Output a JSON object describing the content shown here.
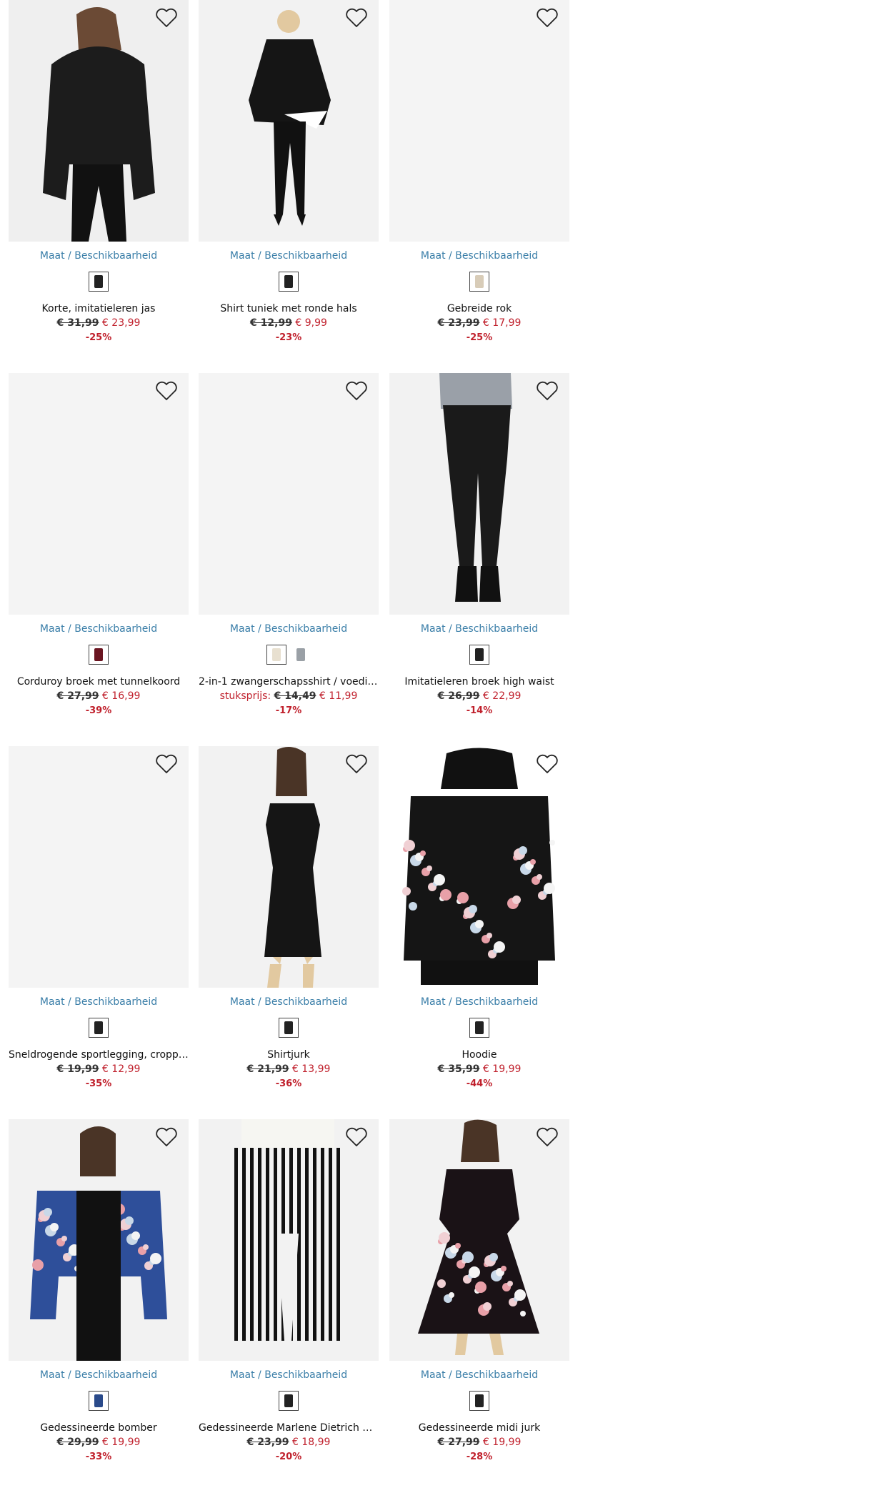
{
  "products": [
    {
      "name": "Korte, imitatieleren jas",
      "old": "€ 31,99",
      "new": "€ 23,99",
      "discount": "-25%",
      "prefix": "",
      "size_link": "Maat / Beschikbaarheid",
      "icon": "jacket-swatch-icon",
      "swatch": "#222222",
      "photo": "jacket"
    },
    {
      "name": "Shirt tuniek met ronde hals",
      "old": "€ 12,99",
      "new": "€ 9,99",
      "discount": "-23%",
      "prefix": "",
      "size_link": "Maat / Beschikbaarheid",
      "icon": "shirt-swatch-icon",
      "swatch": "#222222",
      "photo": "tunic"
    },
    {
      "name": "Gebreide rok",
      "old": "€ 23,99",
      "new": "€ 17,99",
      "discount": "-25%",
      "prefix": "",
      "size_link": "Maat / Beschikbaarheid",
      "icon": "skirt-swatch-icon",
      "swatch": "#d8ccb8",
      "photo": "blank"
    },
    {
      "name": "Corduroy broek met tunnelkoord",
      "old": "€ 27,99",
      "new": "€ 16,99",
      "discount": "-39%",
      "prefix": "",
      "size_link": "Maat / Beschikbaarheid",
      "icon": "trousers-swatch-icon",
      "swatch": "#6a1420",
      "photo": "blank"
    },
    {
      "name": "2-in-1 zwangerschapsshirt / voeding...",
      "old": "€ 14,49",
      "new": "€ 11,99",
      "discount": "-17%",
      "prefix": "stuksprijs:",
      "size_link": "Maat / Beschikbaarheid",
      "icon": "shirt-swatch-icon",
      "swatch": "#e8e0d0",
      "swatch2": "#9aa0a6",
      "photo": "blank"
    },
    {
      "name": "Imitatieleren broek high waist",
      "old": "€ 26,99",
      "new": "€ 22,99",
      "discount": "-14%",
      "prefix": "",
      "size_link": "Maat / Beschikbaarheid",
      "icon": "trousers-swatch-icon",
      "swatch": "#222222",
      "photo": "leggings"
    },
    {
      "name": "Sneldrogende sportlegging, cropped",
      "old": "€ 19,99",
      "new": "€ 12,99",
      "discount": "-35%",
      "prefix": "",
      "size_link": "Maat / Beschikbaarheid",
      "icon": "leggings-swatch-icon",
      "swatch": "#222222",
      "photo": "blank"
    },
    {
      "name": "Shirtjurk",
      "old": "€ 21,99",
      "new": "€ 13,99",
      "discount": "-36%",
      "prefix": "",
      "size_link": "Maat / Beschikbaarheid",
      "icon": "dress-swatch-icon",
      "swatch": "#222222",
      "photo": "dress"
    },
    {
      "name": "Hoodie",
      "old": "€ 35,99",
      "new": "€ 19,99",
      "discount": "-44%",
      "prefix": "",
      "size_link": "Maat / Beschikbaarheid",
      "icon": "hoodie-swatch-icon",
      "swatch": "#222222",
      "photo": "hoodie"
    },
    {
      "name": "Gedessineerde bomber",
      "old": "€ 29,99",
      "new": "€ 19,99",
      "discount": "-33%",
      "prefix": "",
      "size_link": "Maat / Beschikbaarheid",
      "icon": "bomber-swatch-icon",
      "swatch": "#2a4a8a",
      "photo": "bomber"
    },
    {
      "name": "Gedessineerde Marlene Dietrich br...",
      "old": "€ 23,99",
      "new": "€ 18,99",
      "discount": "-20%",
      "prefix": "",
      "size_link": "Maat / Beschikbaarheid",
      "icon": "trousers-swatch-icon",
      "swatch": "#222222",
      "photo": "stripes"
    },
    {
      "name": "Gedessineerde midi jurk",
      "old": "€ 27,99",
      "new": "€ 19,99",
      "discount": "-28%",
      "prefix": "",
      "size_link": "Maat / Beschikbaarheid",
      "icon": "dress-swatch-icon",
      "swatch": "#222222",
      "photo": "floraldress"
    }
  ]
}
